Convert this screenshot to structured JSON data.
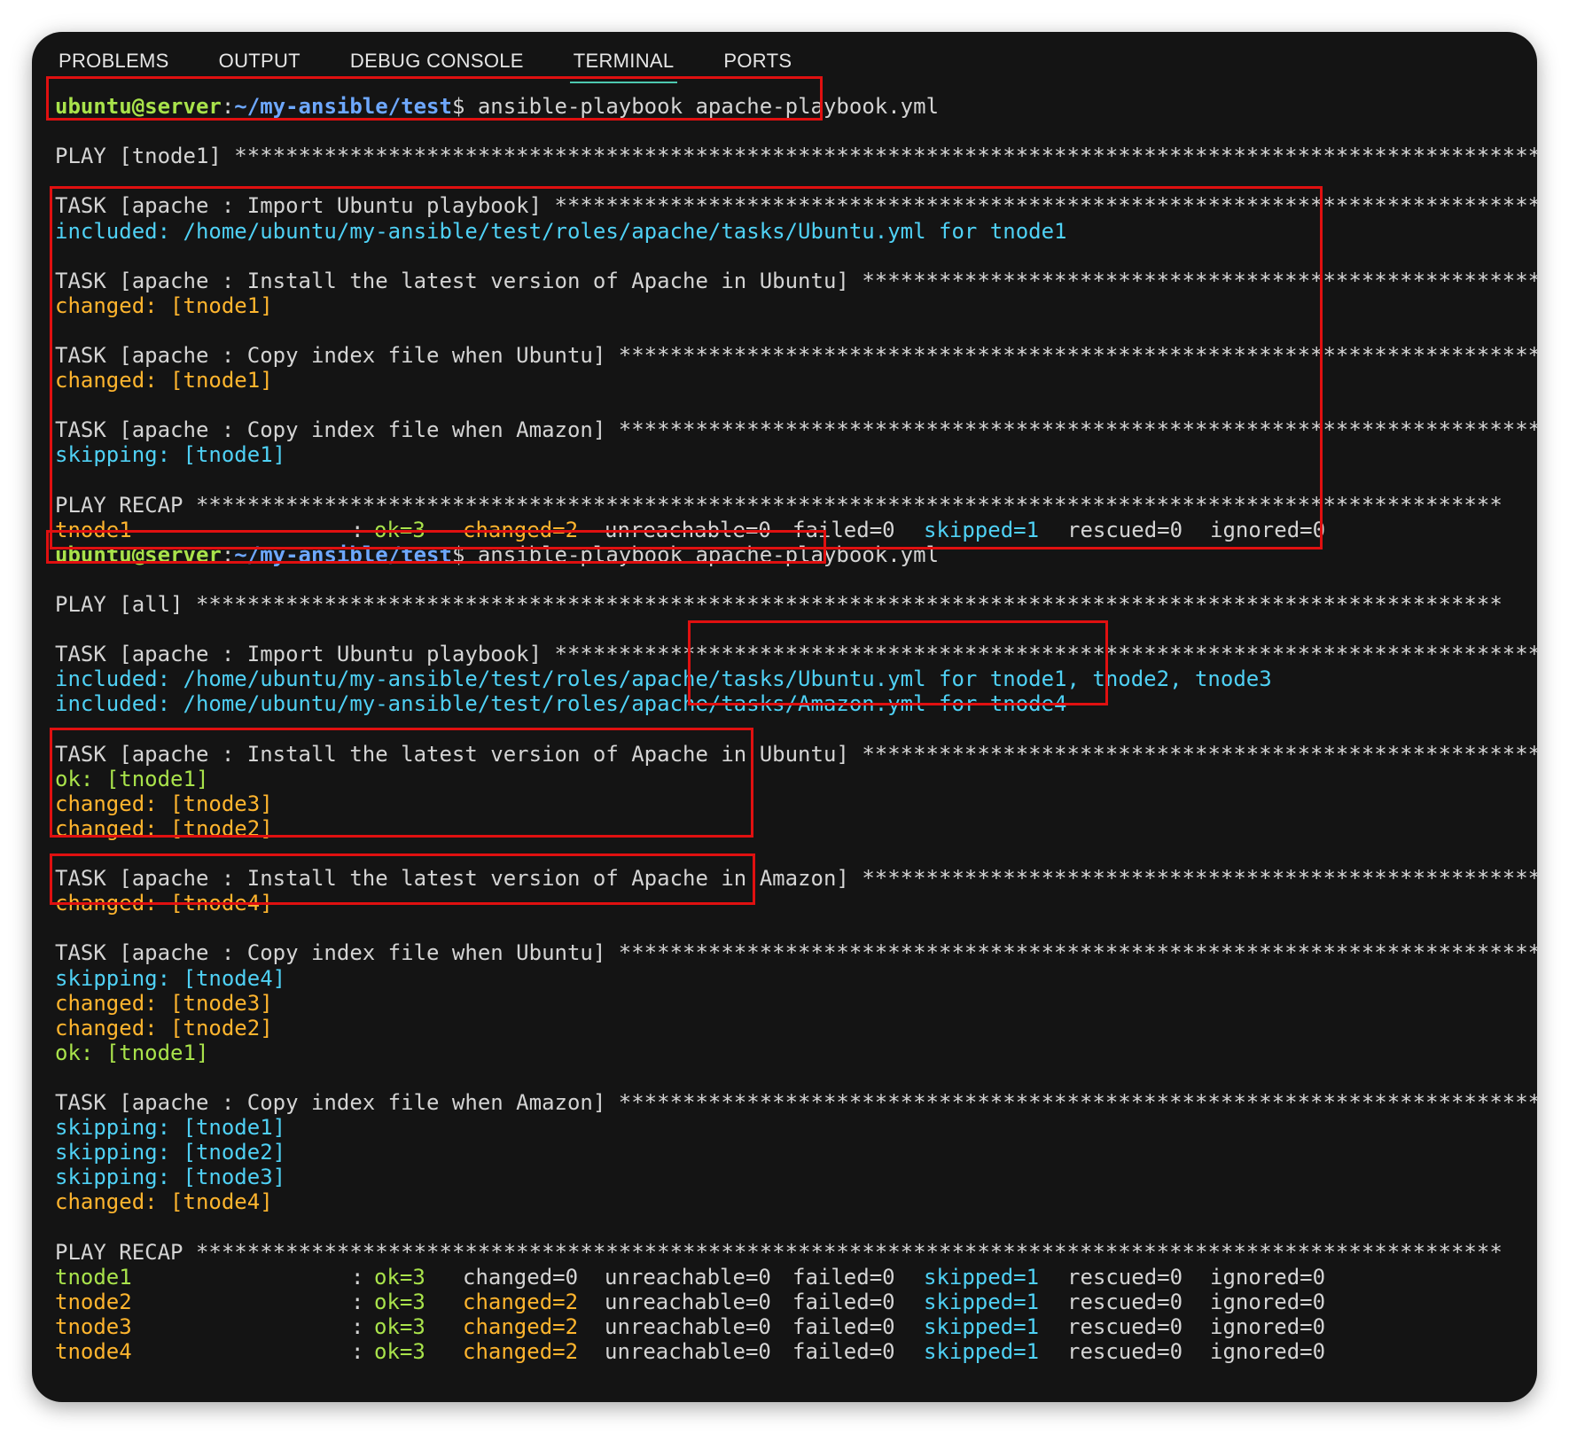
{
  "tabs": [
    "PROBLEMS",
    "OUTPUT",
    "DEBUG CONSOLE",
    "TERMINAL",
    "PORTS"
  ],
  "active_tab": "TERMINAL",
  "prompt": {
    "user": "ubuntu@server",
    "sep": ":",
    "path": "~/my-ansible/test",
    "dollar": "$",
    "command": " ansible-playbook apache-playbook.yml"
  },
  "stars": "******************************************************************************************************",
  "run1": {
    "play": "PLAY [tnode1] ",
    "tasks": [
      {
        "title": "TASK [apache : Import Ubuntu playbook] ",
        "lines": [
          {
            "text": "included: /home/ubuntu/my-ansible/test/roles/apache/tasks/Ubuntu.yml for tnode1",
            "color": "cyan"
          }
        ]
      },
      {
        "title": "TASK [apache : Install the latest version of Apache in Ubuntu] ",
        "lines": [
          {
            "text": "changed: [tnode1]",
            "color": "orange"
          }
        ]
      },
      {
        "title": "TASK [apache : Copy index file when Ubuntu] ",
        "lines": [
          {
            "text": "changed: [tnode1]",
            "color": "orange"
          }
        ]
      },
      {
        "title": "TASK [apache : Copy index file when Amazon] ",
        "lines": [
          {
            "text": "skipping: [tnode1]",
            "color": "cyan"
          }
        ]
      }
    ],
    "recap_title": "PLAY RECAP ",
    "recap": [
      {
        "host": "tnode1",
        "host_color": "orange",
        "ok": "ok=3",
        "changed": "changed=2",
        "changed_color": "orange",
        "unreachable": "unreachable=0",
        "failed": "failed=0",
        "skipped": "skipped=1",
        "rescued": "rescued=0",
        "ignored": "ignored=0"
      }
    ]
  },
  "run2": {
    "play": "PLAY [all] ",
    "tasks": [
      {
        "title": "TASK [apache : Import Ubuntu playbook] ",
        "lines": [
          {
            "text": "included: /home/ubuntu/my-ansible/test/roles/apache/tasks/Ubuntu.yml for tnode1, tnode2, tnode3",
            "color": "cyan"
          },
          {
            "text": "included: /home/ubuntu/my-ansible/test/roles/apache/tasks/Amazon.yml for tnode4",
            "color": "cyan"
          }
        ]
      },
      {
        "title": "TASK [apache : Install the latest version of Apache in Ubuntu] ",
        "lines": [
          {
            "text": "ok: [tnode1]",
            "color": "green"
          },
          {
            "text": "changed: [tnode3]",
            "color": "orange"
          },
          {
            "text": "changed: [tnode2]",
            "color": "orange"
          }
        ]
      },
      {
        "title": "TASK [apache : Install the latest version of Apache in Amazon] ",
        "lines": [
          {
            "text": "changed: [tnode4]",
            "color": "orange"
          }
        ]
      },
      {
        "title": "TASK [apache : Copy index file when Ubuntu] ",
        "lines": [
          {
            "text": "skipping: [tnode4]",
            "color": "cyan"
          },
          {
            "text": "changed: [tnode3]",
            "color": "orange"
          },
          {
            "text": "changed: [tnode2]",
            "color": "orange"
          },
          {
            "text": "ok: [tnode1]",
            "color": "green"
          }
        ]
      },
      {
        "title": "TASK [apache : Copy index file when Amazon] ",
        "lines": [
          {
            "text": "skipping: [tnode1]",
            "color": "cyan"
          },
          {
            "text": "skipping: [tnode2]",
            "color": "cyan"
          },
          {
            "text": "skipping: [tnode3]",
            "color": "cyan"
          },
          {
            "text": "changed: [tnode4]",
            "color": "orange"
          }
        ]
      }
    ],
    "recap_title": "PLAY RECAP ",
    "recap": [
      {
        "host": "tnode1",
        "host_color": "green",
        "ok": "ok=3",
        "changed": "changed=0",
        "changed_color": "white",
        "unreachable": "unreachable=0",
        "failed": "failed=0",
        "skipped": "skipped=1",
        "rescued": "rescued=0",
        "ignored": "ignored=0"
      },
      {
        "host": "tnode2",
        "host_color": "orange",
        "ok": "ok=3",
        "changed": "changed=2",
        "changed_color": "orange",
        "unreachable": "unreachable=0",
        "failed": "failed=0",
        "skipped": "skipped=1",
        "rescued": "rescued=0",
        "ignored": "ignored=0"
      },
      {
        "host": "tnode3",
        "host_color": "orange",
        "ok": "ok=3",
        "changed": "changed=2",
        "changed_color": "orange",
        "unreachable": "unreachable=0",
        "failed": "failed=0",
        "skipped": "skipped=1",
        "rescued": "rescued=0",
        "ignored": "ignored=0"
      },
      {
        "host": "tnode4",
        "host_color": "orange",
        "ok": "ok=3",
        "changed": "changed=2",
        "changed_color": "orange",
        "unreachable": "unreachable=0",
        "failed": "failed=0",
        "skipped": "skipped=1",
        "rescued": "rescued=0",
        "ignored": "ignored=0"
      }
    ]
  },
  "colors": {
    "user": "#a9e34b",
    "path": "#6ea8ff",
    "cyan": "#4fd1f5",
    "orange": "#ffb52e",
    "green": "#a9e34b",
    "text": "#d4d4d4",
    "highlight_box": "#e01010",
    "background": "#141414"
  }
}
